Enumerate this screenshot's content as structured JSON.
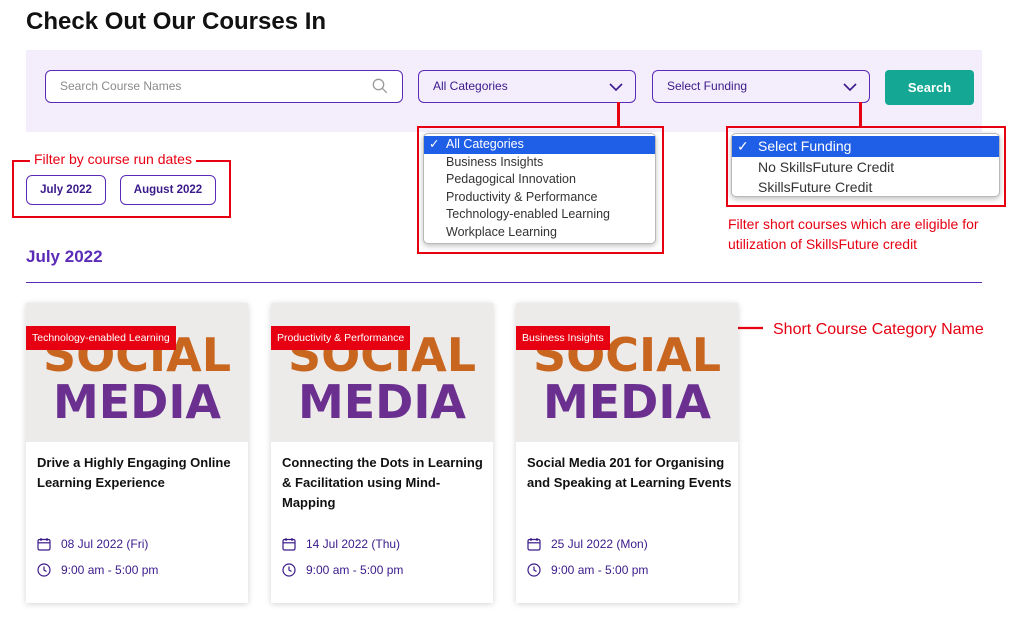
{
  "page": {
    "title": "Check Out Our Courses In"
  },
  "search": {
    "placeholder": "Search Course Names",
    "value": "",
    "button_label": "Search"
  },
  "category_select": {
    "selected": "All Categories",
    "options": [
      "All Categories",
      "Business Insights",
      "Pedagogical Innovation",
      "Productivity & Performance",
      "Technology-enabled Learning",
      "Workplace Learning"
    ]
  },
  "funding_select": {
    "selected": "Select Funding",
    "options": [
      "Select Funding",
      "No SkillsFuture Credit",
      "SkillsFuture Credit"
    ]
  },
  "date_filters": [
    "July 2022",
    "August 2022"
  ],
  "annotations": {
    "dates": "Filter by course run dates",
    "funding": "Filter short courses which are eligible for utilization of  SkillsFuture credit",
    "category": "Short Course Category Name"
  },
  "section": {
    "title": "July 2022"
  },
  "cards": [
    {
      "category": "Technology-enabled Learning",
      "title": "Drive a Highly Engaging Online Learning Experience",
      "date": "08 Jul 2022 (Fri)",
      "time": "9:00 am - 5:00 pm",
      "image_text": [
        "SOCIAL",
        "MEDIA"
      ]
    },
    {
      "category": "Productivity & Performance",
      "title": "Connecting the Dots in Learning & Facilitation using Mind-Mapping",
      "date": "14 Jul 2022 (Thu)",
      "time": "9:00 am - 5:00 pm",
      "image_text": [
        "SOCIAL",
        "MEDIA"
      ]
    },
    {
      "category": "Business Insights",
      "title": "Social Media 201 for Organising and Speaking at Learning Events",
      "date": "25 Jul 2022 (Mon)",
      "time": "9:00 am - 5:00 pm",
      "image_text": [
        "SOCIAL",
        "MEDIA"
      ]
    }
  ],
  "colors": {
    "brand_purple": "#5b2bb8",
    "accent_teal": "#14a894",
    "annotation_red": "#e60012",
    "selected_blue": "#1f5ee6"
  },
  "icons": {
    "search": "search-icon",
    "dropdown": "chevron-down-icon",
    "check": "check-icon",
    "date": "calendar-icon",
    "time": "clock-icon"
  }
}
